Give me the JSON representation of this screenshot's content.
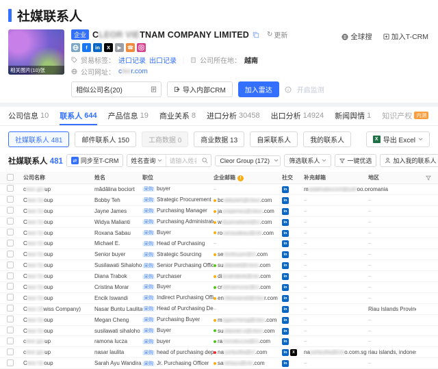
{
  "colors": {
    "primary": "#3370ff",
    "warn": "#faad14",
    "ok": "#52c41a",
    "bad": "#f5222d",
    "linkedin": "#0a66c2",
    "x": "#000000"
  },
  "page": {
    "title": "社媒联系人"
  },
  "header": {
    "global_search": "全球搜",
    "join_tcrm": "加入T-CRM",
    "company": {
      "badge": "企业",
      "name_pre": "C",
      "name_blur": "LEOR VIE",
      "name_post": "TNAM COMPANY LIMITED",
      "update": "更新",
      "photo_caption": "相关图片(10)张",
      "trade_label": "贸易标签：",
      "import_record": "进口记录",
      "export_record": "出口记录",
      "location_label": "公司所在地：",
      "location": "越南",
      "website_label": "公司网址：",
      "website_pre": "c",
      "website_blur": "leo",
      "website_post": "r.com",
      "similar_company": "相似公司名(20)",
      "import_crm": "导入内部CRM",
      "join_radar": "加入雷达",
      "enable_monitor": "开启监测"
    },
    "social_icons": [
      {
        "name": "website-icon",
        "bg": "#7aa7c7",
        "glyph": "globe"
      },
      {
        "name": "facebook-icon",
        "bg": "#1877f2",
        "glyph": "f"
      },
      {
        "name": "linkedin-icon",
        "bg": "#0a66c2",
        "glyph": "in"
      },
      {
        "name": "x-icon",
        "bg": "#000000",
        "glyph": "X"
      },
      {
        "name": "youtube-icon",
        "bg": "#9aa0a6",
        "glyph": "play"
      },
      {
        "name": "phone-icon",
        "bg": "#f08a3c",
        "glyph": "phone"
      },
      {
        "name": "instagram-icon",
        "bg": "#d6428e",
        "glyph": "camera"
      }
    ]
  },
  "tabs": [
    {
      "id": "company-info",
      "label": "公司信息",
      "count": "10"
    },
    {
      "id": "contacts",
      "label": "联系人",
      "count": "644",
      "active": true
    },
    {
      "id": "product-info",
      "label": "产品信息",
      "count": "19"
    },
    {
      "id": "business-relations",
      "label": "商业关系",
      "count": "8"
    },
    {
      "id": "import-analysis",
      "label": "进口分析",
      "count": "30458"
    },
    {
      "id": "export-analysis",
      "label": "出口分析",
      "count": "14924"
    },
    {
      "id": "news-sentiment",
      "label": "新闻舆情",
      "count": "1"
    },
    {
      "id": "intellectual-property",
      "label": "知识产权",
      "count": "",
      "dim": true,
      "badge": "内测"
    }
  ],
  "subtabs": [
    {
      "id": "social-media-contacts",
      "label": "社媒联系人",
      "count": "481",
      "state": "active"
    },
    {
      "id": "email-contacts",
      "label": "邮件联系人",
      "count": "150",
      "state": "normal"
    },
    {
      "id": "business-registry-data",
      "label": "工商数据",
      "count": "0",
      "state": "disabled"
    },
    {
      "id": "business-data",
      "label": "商业数据",
      "count": "13",
      "state": "normal"
    },
    {
      "id": "self-collected-contacts",
      "label": "自采联系人",
      "count": "",
      "state": "normal"
    },
    {
      "id": "my-contacts",
      "label": "我的联系人",
      "count": "",
      "state": "normal"
    }
  ],
  "export_excel": "导出 Excel",
  "section": {
    "title": "社媒联系人",
    "count": "481",
    "sync_tcrm": "同步至T-CRM",
    "name_query": "姓名查询",
    "name_placeholder": "请输入姓名",
    "group_select": "Cleor Group (172)",
    "filter_contacts": "筛选联系人",
    "one_click": "一键优选",
    "add_my_contacts": "加入我的联系人"
  },
  "table": {
    "headers": [
      "公司名称",
      "姓名",
      "职位",
      "企业邮箱",
      "社交",
      "补充邮箱",
      "地区"
    ],
    "position_tag": "采购",
    "empty": "–",
    "rows": [
      {
        "co": {
          "pre": "c",
          "blur": "leor gro",
          "post": "up"
        },
        "name": "mădălina bociort",
        "pos": "buyer",
        "email": null,
        "social": [
          "linkedin"
        ],
        "extra": {
          "pre": "m",
          "blur": "adalinabociort@yah",
          "post": "oo.com"
        },
        "region": "romania"
      },
      {
        "co": {
          "pre": "C",
          "blur": "leor Gr",
          "post": "oup"
        },
        "name": "Bobby Teh",
        "pos": "Strategic Procurement",
        "email": {
          "pre": "bc",
          "blur": "obbyteh@cleor",
          "post": ".com",
          "dot": "warn"
        },
        "social": [
          "linkedin"
        ],
        "extra": null,
        "region": null
      },
      {
        "co": {
          "pre": "C",
          "blur": "leor Gr",
          "post": "oup"
        },
        "name": "Jayne James",
        "pos": "Purchasing Manager",
        "email": {
          "pre": "ja",
          "blur": "ynejames@cleor",
          "post": ".com",
          "dot": "warn"
        },
        "social": [
          "linkedin"
        ],
        "extra": null,
        "region": null
      },
      {
        "co": {
          "pre": "C",
          "blur": "leor Gr",
          "post": "oup"
        },
        "name": "Widya Malianti",
        "pos": "Purchasing Administrator",
        "email": {
          "pre": "w",
          "blur": "idyamalianti@cl",
          "post": ".com",
          "dot": "warn"
        },
        "social": [
          "linkedin"
        ],
        "extra": null,
        "region": null
      },
      {
        "co": {
          "pre": "C",
          "blur": "leor Gr",
          "post": "oup"
        },
        "name": "Roxana Sabau",
        "pos": "Buyer",
        "email": {
          "pre": "ro",
          "blur": "xanasabau@cle",
          "post": ".com",
          "dot": "warn"
        },
        "social": [
          "linkedin"
        ],
        "extra": null,
        "region": null
      },
      {
        "co": {
          "pre": "C",
          "blur": "leor Gr",
          "post": "oup"
        },
        "name": "Michael E.",
        "pos": "Head of Purchasing",
        "email": null,
        "social": [
          "linkedin"
        ],
        "extra": null,
        "region": null
      },
      {
        "co": {
          "pre": "C",
          "blur": "leor Gr",
          "post": "oup"
        },
        "name": "Senior buyer",
        "pos": "Strategic Sourcing",
        "email": {
          "pre": "se",
          "blur": "niorbuyer@cl",
          "post": ".com",
          "dot": "warn"
        },
        "social": [
          "linkedin"
        ],
        "extra": null,
        "region": null
      },
      {
        "co": {
          "pre": "C",
          "blur": "leor Gr",
          "post": "oup"
        },
        "name": "Susilawati Sihaloho",
        "pos": "Senior Purchasing Officer",
        "email": {
          "pre": "su",
          "blur": "silawati@cleor",
          "post": ".com",
          "dot": "ok"
        },
        "social": [
          "linkedin"
        ],
        "extra": null,
        "region": null
      },
      {
        "co": {
          "pre": "C",
          "blur": "leor Gr",
          "post": "oup"
        },
        "name": "Diana Trabok",
        "pos": "Purchaser",
        "email": {
          "pre": "di",
          "blur": "anatrabok@cle",
          "post": ".com",
          "dot": "warn"
        },
        "social": [
          "linkedin"
        ],
        "extra": null,
        "region": null
      },
      {
        "co": {
          "pre": "C",
          "blur": "leor Gr",
          "post": "oup"
        },
        "name": "Cristina Morar",
        "pos": "Buyer",
        "email": {
          "pre": "cr",
          "blur": "istinamorar@cl",
          "post": ".com",
          "dot": "ok"
        },
        "social": [
          "linkedin"
        ],
        "extra": null,
        "region": null
      },
      {
        "co": {
          "pre": "C",
          "blur": "leor Gr",
          "post": "oup"
        },
        "name": "Encik Iswandi",
        "pos": "Indirect Purchasing Officer",
        "email": {
          "pre": "en",
          "blur": "cikiswandi@cleo",
          "post": "r.com",
          "dot": "warn"
        },
        "social": [
          "linkedin"
        ],
        "extra": null,
        "region": null
      },
      {
        "co": {
          "pre": "C",
          "blur": "leor (S",
          "post": "wiss Company)"
        },
        "name": "Nasar Buntu Laulita, …",
        "pos": "Head of Purchasing Dep…",
        "email": null,
        "social": [
          "linkedin"
        ],
        "extra": null,
        "region": "Riau Islands Province…"
      },
      {
        "co": {
          "pre": "C",
          "blur": "leor Gr",
          "post": "oup"
        },
        "name": "Megan Cheng",
        "pos": "Purchasing Buyer",
        "email": {
          "pre": "m",
          "blur": "egancheng@cleo",
          "post": ".com",
          "dot": "warn"
        },
        "social": [
          "linkedin"
        ],
        "extra": null,
        "region": null
      },
      {
        "co": {
          "pre": "C",
          "blur": "leor Gr",
          "post": "oup"
        },
        "name": "susilawati sihaloho",
        "pos": "Buyer",
        "email": {
          "pre": "su",
          "blur": "silawati.s@cleor",
          "post": ".com",
          "dot": "ok"
        },
        "social": [
          "linkedin"
        ],
        "extra": null,
        "region": null
      },
      {
        "co": {
          "pre": "c",
          "blur": "leor gro",
          "post": "up"
        },
        "name": "ramona lucza",
        "pos": "buyer",
        "email": {
          "pre": "ra",
          "blur": "monalucza@cl",
          "post": ".com",
          "dot": "ok"
        },
        "social": [
          "linkedin"
        ],
        "extra": null,
        "region": null
      },
      {
        "co": {
          "pre": "c",
          "blur": "leor gro",
          "post": "up"
        },
        "name": "nasar laulita",
        "pos": "head of purchasing depa…",
        "email": {
          "pre": "na",
          "blur": "sarlaulita@cl",
          "post": ".com",
          "dot": "bad"
        },
        "social": [
          "linkedin",
          "x"
        ],
        "extra": {
          "pre": "na",
          "blur": "sarlaulita@cle",
          "post": "o.com.sg"
        },
        "region": "riau islands, indonesia"
      },
      {
        "co": {
          "pre": "C",
          "blur": "leor Gr",
          "post": "oup"
        },
        "name": "Sarah Ayu Wandira",
        "pos": "Jr. Purchasing Officer",
        "email": {
          "pre": "sa",
          "blur": "rahayu@cle",
          "post": ".com",
          "dot": "warn"
        },
        "social": [
          "linkedin"
        ],
        "extra": null,
        "region": null
      }
    ]
  }
}
